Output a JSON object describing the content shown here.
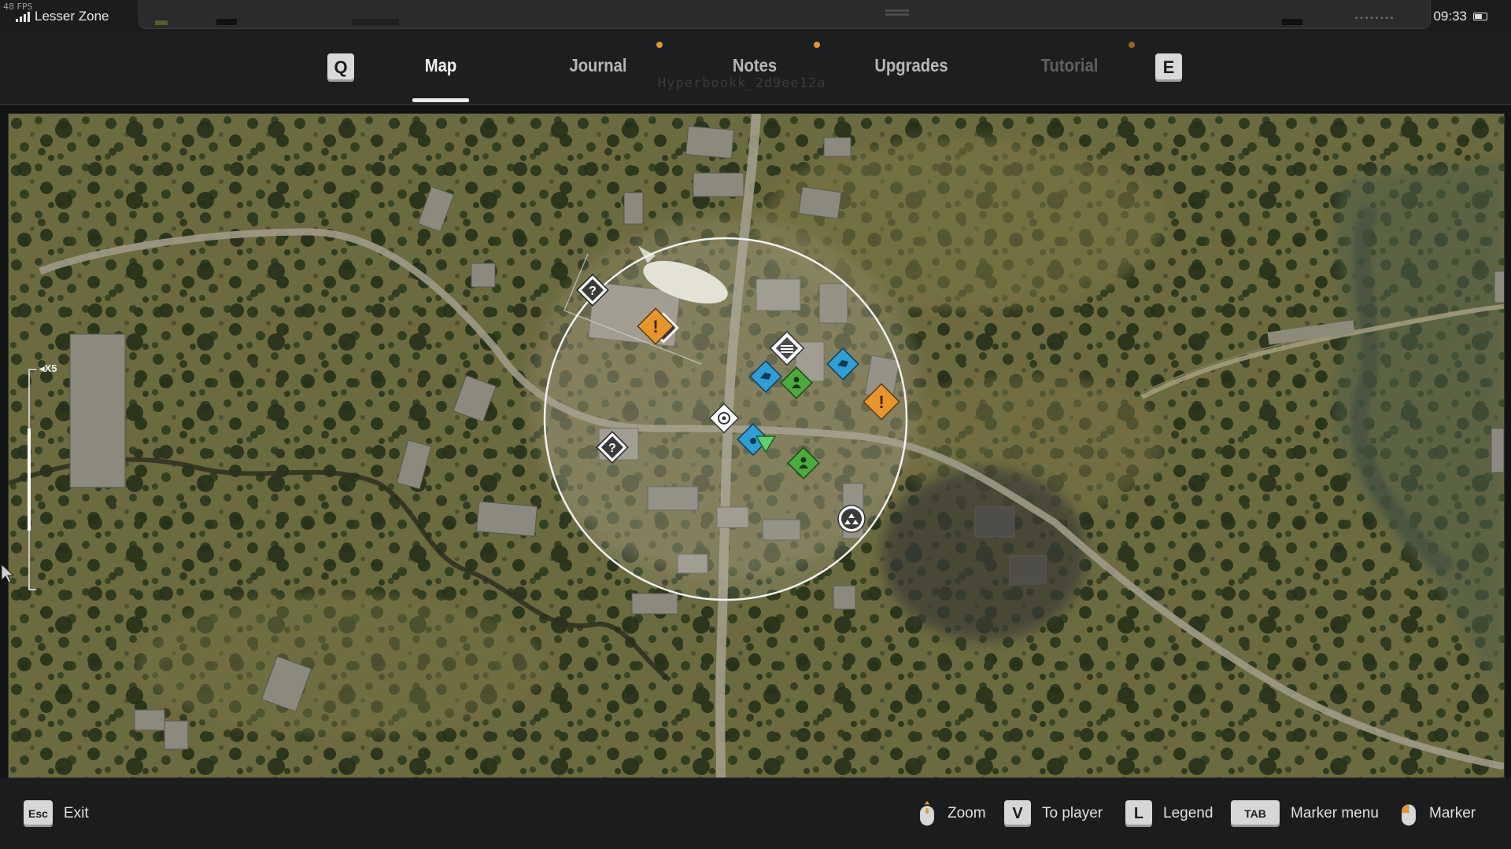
{
  "status": {
    "fps": "48 FPS",
    "zone": "Lesser Zone",
    "time": "09:33"
  },
  "tabs": {
    "prev_key": "Q",
    "next_key": "E",
    "items": [
      {
        "label": "Map",
        "active": true,
        "notify": false
      },
      {
        "label": "Journal",
        "active": false,
        "notify": true
      },
      {
        "label": "Notes",
        "active": false,
        "notify": true
      },
      {
        "label": "Upgrades",
        "active": false,
        "notify": false
      },
      {
        "label": "Tutorial",
        "active": false,
        "notify": true
      }
    ],
    "watermark": "Hyperbookk_2d9ee12a"
  },
  "map": {
    "zoom_label": "X5",
    "zoom_level": 5,
    "markers": [
      {
        "type": "unknown",
        "icon": "question-icon"
      },
      {
        "type": "unknown",
        "icon": "question-icon"
      },
      {
        "type": "quest",
        "icon": "exclamation-icon",
        "color": "#e8952a"
      },
      {
        "type": "quest",
        "icon": "exclamation-icon",
        "color": "#e8952a"
      },
      {
        "type": "trader",
        "icon": "trader-icon",
        "color": "#2e9fd6"
      },
      {
        "type": "trader",
        "icon": "trader-icon",
        "color": "#2e9fd6"
      },
      {
        "type": "trader",
        "icon": "trader-icon",
        "color": "#2e9fd6"
      },
      {
        "type": "friendly",
        "icon": "person-icon",
        "color": "#4caa3e"
      },
      {
        "type": "friendly",
        "icon": "person-icon",
        "color": "#4caa3e"
      },
      {
        "type": "player",
        "icon": "player-arrow-icon",
        "color": "#5fd06a"
      },
      {
        "type": "waypoint",
        "icon": "waypoint-icon"
      },
      {
        "type": "stash",
        "icon": "stash-icon"
      },
      {
        "type": "anomaly",
        "icon": "anomaly-icon"
      }
    ]
  },
  "footer": {
    "exit": {
      "key": "Esc",
      "label": "Exit"
    },
    "hints": [
      {
        "key": "mouse-scroll",
        "label": "Zoom"
      },
      {
        "key": "V",
        "label": "To player"
      },
      {
        "key": "L",
        "label": "Legend"
      },
      {
        "key": "TAB",
        "label": "Marker menu"
      },
      {
        "key": "mouse-left",
        "label": "Marker"
      }
    ]
  },
  "colors": {
    "accent_orange": "#e8952a",
    "trader_blue": "#2e9fd6",
    "friendly_green": "#4caa3e"
  }
}
